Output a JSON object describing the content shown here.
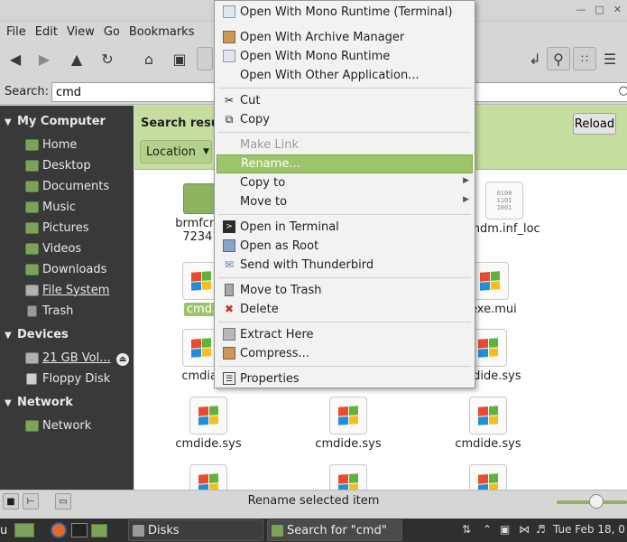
{
  "menubar": [
    "File",
    "Edit",
    "View",
    "Go",
    "Bookmarks"
  ],
  "search": {
    "label": "Search:",
    "value": "cmd"
  },
  "sidebar": {
    "my_computer": "My Computer",
    "computer_items": [
      "Home",
      "Desktop",
      "Documents",
      "Music",
      "Pictures",
      "Videos",
      "Downloads",
      "File System",
      "Trash"
    ],
    "devices": "Devices",
    "device_items": [
      "21 GB Vol...",
      "Floppy Disk"
    ],
    "network": "Network",
    "network_items": [
      "Network"
    ]
  },
  "banner": {
    "title": "Search resu",
    "location": "Location",
    "reload": "Reload"
  },
  "files": [
    {
      "name": "brmfcmc",
      "name2": "72341"
    },
    {
      "name": "mdm.inf_loc"
    },
    {
      "name": "cmd."
    },
    {
      "name": "l.exe.mui"
    },
    {
      "name": "cmdial"
    },
    {
      "name": "cmdide.sys"
    },
    {
      "name": "cmdide.sys"
    },
    {
      "name": "cmdide.sys"
    },
    {
      "name": "cmdide.sys"
    }
  ],
  "binary_lines": [
    "0100",
    "1101",
    "1001"
  ],
  "context_menu": [
    {
      "label": "Open With Mono Runtime (Terminal)",
      "icon": "mono-icon"
    },
    {
      "label": "Open With Archive Manager",
      "icon": "archive-icon"
    },
    {
      "label": "Open With Mono Runtime",
      "icon": "mono-icon"
    },
    {
      "label": "Open With Other Application...",
      "icon": ""
    },
    {
      "label": "Cut",
      "icon": "cut-icon"
    },
    {
      "label": "Copy",
      "icon": "copy-icon"
    },
    {
      "label": "Make Link",
      "icon": ""
    },
    {
      "label": "Rename...",
      "icon": ""
    },
    {
      "label": "Copy to",
      "icon": ""
    },
    {
      "label": "Move to",
      "icon": ""
    },
    {
      "label": "Open in Terminal",
      "icon": "terminal-icon"
    },
    {
      "label": "Open as Root",
      "icon": "root-icon"
    },
    {
      "label": "Send with Thunderbird",
      "icon": "thunderbird-icon"
    },
    {
      "label": "Move to Trash",
      "icon": "trash-icon"
    },
    {
      "label": "Delete",
      "icon": "delete-icon"
    },
    {
      "label": "Extract Here",
      "icon": "extract-icon"
    },
    {
      "label": "Compress...",
      "icon": "compress-icon"
    },
    {
      "label": "Properties",
      "icon": "properties-icon"
    }
  ],
  "status": {
    "text": "Rename selected item"
  },
  "taskbar": {
    "start_fragment": "u",
    "tasks": [
      "Disks",
      "Search for \"cmd\""
    ],
    "clock": "Tue Feb 18, 0"
  },
  "colors": {
    "accent": "#9ec46a",
    "banner": "#c5de9f",
    "sidebar": "#393939"
  }
}
